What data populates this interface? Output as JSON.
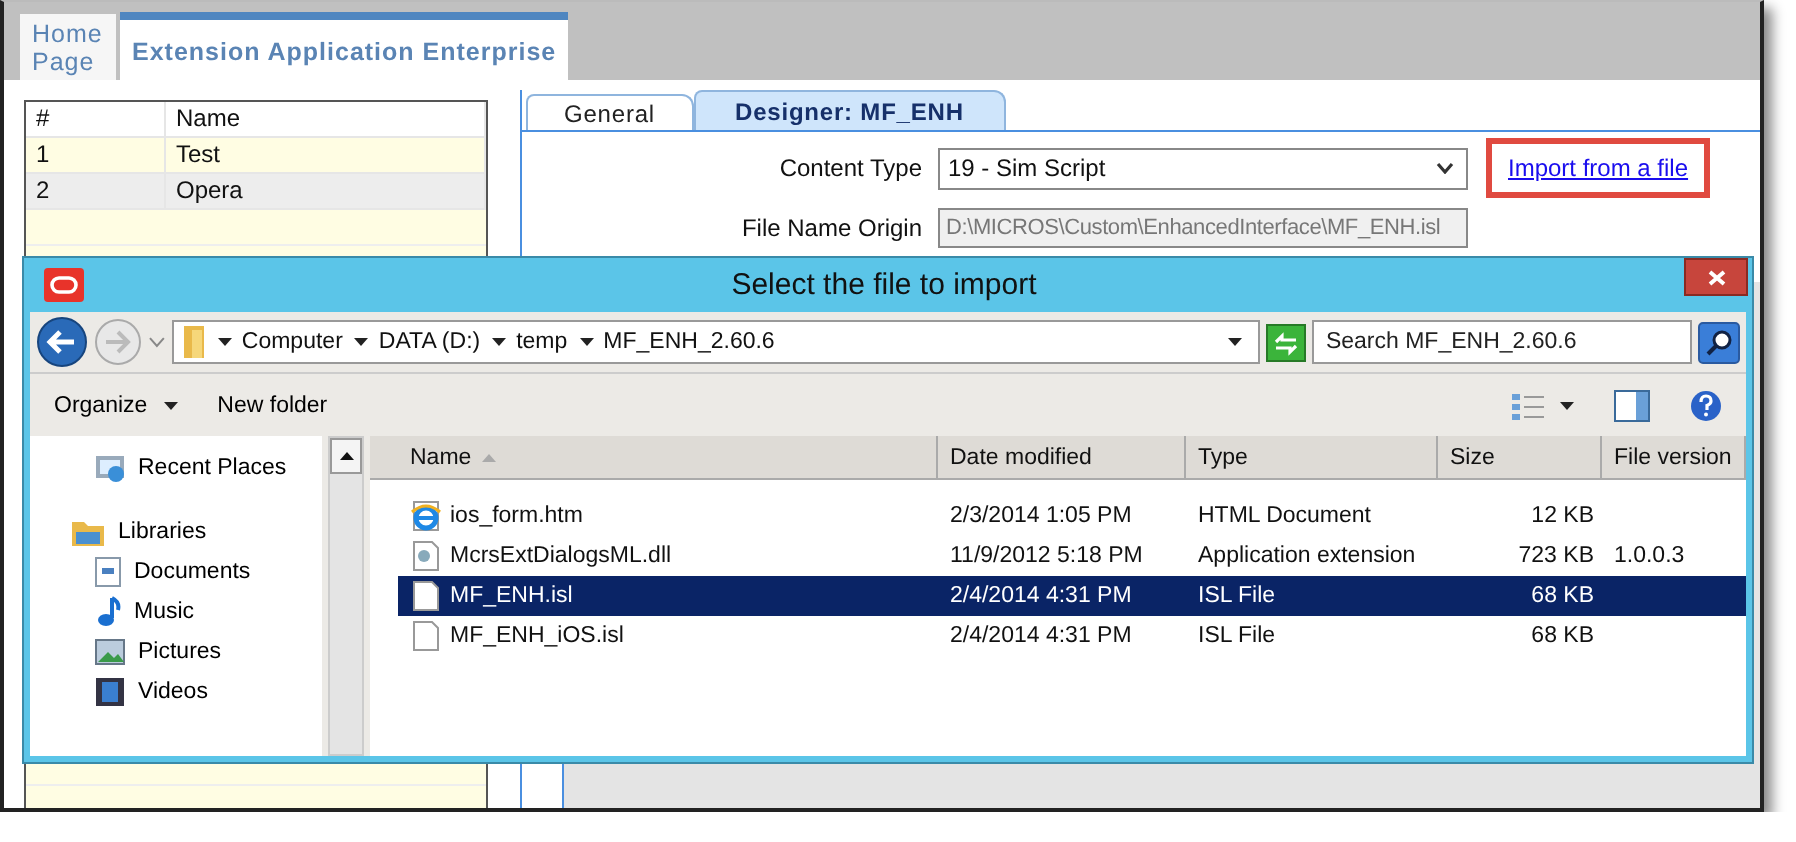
{
  "app_tabs": [
    {
      "label": "Home Page",
      "selected": false
    },
    {
      "label": "Extension Application Enterprise",
      "selected": true
    }
  ],
  "list": {
    "columns": [
      "#",
      "Name"
    ],
    "rows": [
      {
        "cells": [
          "1",
          "Test"
        ],
        "selected": false
      },
      {
        "cells": [
          "2",
          "Opera"
        ],
        "selected": true
      }
    ]
  },
  "designer_tabs": [
    {
      "label": "General",
      "selected": false
    },
    {
      "label": "Designer: MF_ENH",
      "selected": true
    }
  ],
  "form": {
    "content_type": {
      "label": "Content Type",
      "value": "19 - Sim Script"
    },
    "import_link": "Import from a file",
    "file_name_origin": {
      "label": "File Name Origin",
      "value": "D:\\MICROS\\Custom\\EnhancedInterface\\MF_ENH.isl"
    }
  },
  "dialog": {
    "title": "Select the file to import",
    "breadcrumb": [
      "Computer",
      "DATA (D:)",
      "temp",
      "MF_ENH_2.60.6"
    ],
    "search": {
      "placeholder": "Search MF_ENH_2.60.6"
    },
    "toolbar": [
      "Organize",
      "New folder"
    ],
    "nav": [
      {
        "label": "Recent Places",
        "kind": "recent"
      },
      {
        "label": "Libraries",
        "kind": "library",
        "children": [
          {
            "label": "Documents",
            "kind": "documents"
          },
          {
            "label": "Music",
            "kind": "music"
          },
          {
            "label": "Pictures",
            "kind": "pictures"
          },
          {
            "label": "Videos",
            "kind": "videos"
          }
        ]
      }
    ],
    "files": {
      "columns": [
        "Name",
        "Date modified",
        "Type",
        "Size",
        "File version"
      ],
      "rows": [
        {
          "kind": "web",
          "name": "ios_form.htm",
          "date": "2/3/2014 1:05 PM",
          "type": "HTML Document",
          "size": "12 KB",
          "selected": false
        },
        {
          "kind": "dll",
          "name": "McrsExtDialogsML.dll",
          "date": "11/9/2012 5:18 PM",
          "type": "Application extension",
          "size": "723 KB",
          "version": "1.0.0.3",
          "selected": false
        },
        {
          "kind": "file",
          "name": "MF_ENH.isl",
          "date": "2/4/2014 4:31 PM",
          "type": "ISL File",
          "size": "68 KB",
          "selected": true
        },
        {
          "kind": "file",
          "name": "MF_ENH_iOS.isl",
          "date": "2/4/2014 4:31 PM",
          "type": "ISL File",
          "size": "68 KB",
          "selected": false
        }
      ]
    }
  }
}
